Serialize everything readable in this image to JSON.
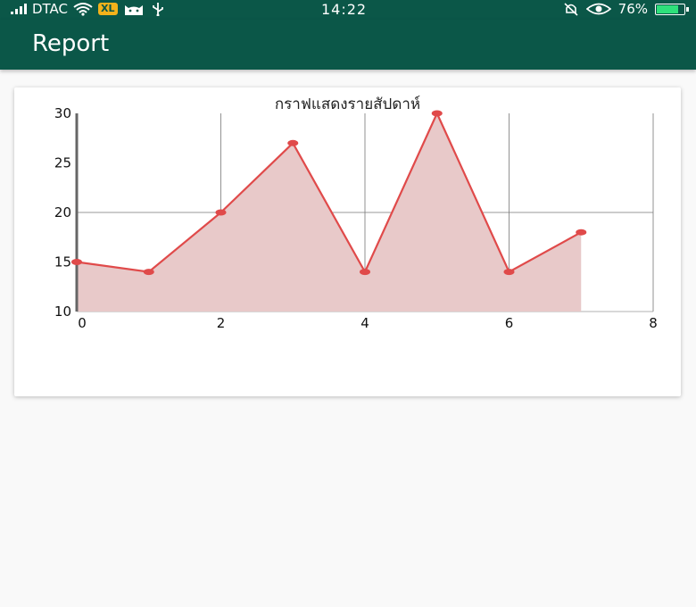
{
  "status_bar": {
    "carrier": "DTAC",
    "badge": "XL",
    "time": "14:22",
    "battery_text": "76%",
    "battery_level": 0.76,
    "icons": [
      "signal-icon",
      "wifi-icon",
      "cat-icon",
      "usb-icon",
      "bell-muted-icon",
      "eye-icon",
      "battery-icon"
    ]
  },
  "app_bar": {
    "title": "Report"
  },
  "colors": {
    "primary": "#0b5748",
    "line": "#e04a4a",
    "fill": "#e8c9c9"
  },
  "chart_data": {
    "type": "area",
    "title": "กราฟแสดงรายสัปดาห์",
    "x": [
      0,
      1,
      2,
      3,
      4,
      5,
      6,
      7
    ],
    "values": [
      15,
      14,
      20,
      27,
      14,
      30,
      14,
      18
    ],
    "xlim": [
      0,
      8
    ],
    "ylim": [
      10,
      30
    ],
    "xticks": [
      "0",
      "2",
      "4",
      "6",
      "8"
    ],
    "yticks": [
      "10",
      "15",
      "20",
      "25",
      "30"
    ],
    "grid": true,
    "legend": "none"
  }
}
